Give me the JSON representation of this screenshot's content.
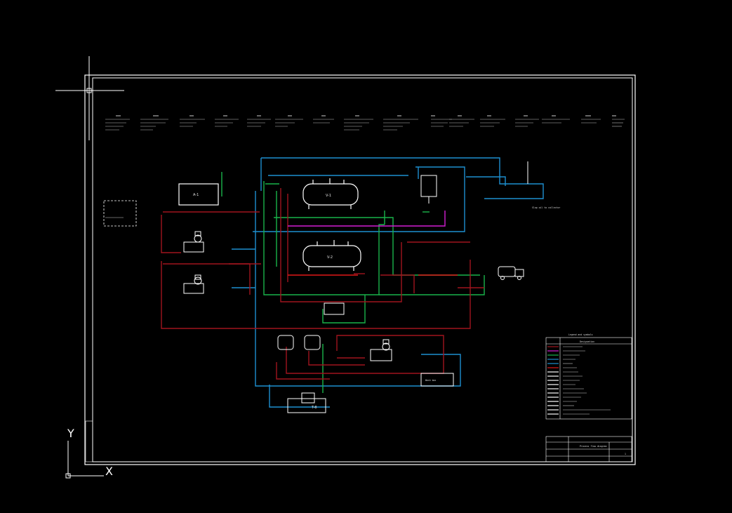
{
  "colors": {
    "background": "#000000",
    "frame": "#ffffff",
    "pipe_blue": "#1e8fd0",
    "pipe_red": "#a0141e",
    "pipe_green": "#19b44a",
    "pipe_magenta": "#d21ed2",
    "pipe_bright_red": "#e01818",
    "equipment": "#ffffff"
  },
  "ucs": {
    "x_label": "X",
    "y_label": "Y"
  },
  "equipment_labels": {
    "vessel_1": "V-1",
    "vessel_2": "V-2",
    "tank_top": "A-1",
    "tank_bottom": "T-8"
  },
  "notes": {
    "drain_note": "Slop oil to collector",
    "box_note": "Wash box"
  },
  "legend": {
    "title": "Legend and symbols",
    "header": "Designation"
  },
  "title_block": {
    "drawing_title": "Process flow diagram",
    "sheet": "1"
  },
  "icons": {
    "truck": "truck-icon",
    "pump": "pump-icon",
    "ucs": "ucs-axes-icon",
    "crosshair": "crosshair-cursor-icon"
  }
}
